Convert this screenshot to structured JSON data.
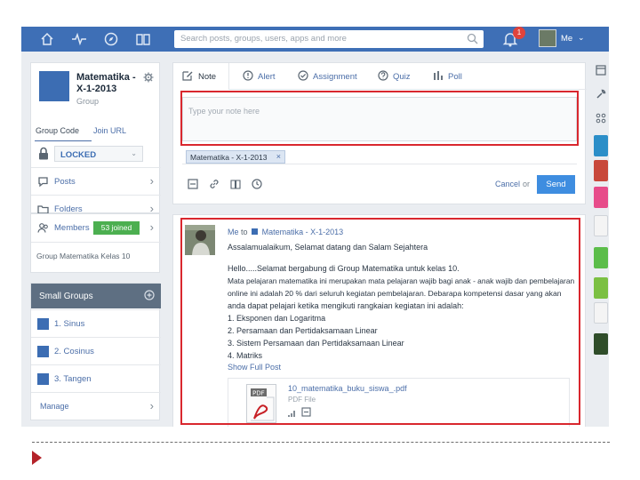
{
  "topbar": {
    "search_placeholder": "Search posts, groups, users, apps and more",
    "notifications_count": "1",
    "me_label": "Me",
    "nav_icons": [
      "home-icon",
      "activity-icon",
      "discover-icon",
      "backpack-icon"
    ]
  },
  "group": {
    "name": "Matematika - X-1-2013",
    "subtitle": "Group",
    "code_tabs": [
      "Group Code",
      "Join URL"
    ],
    "code_value": "LOCKED",
    "menu": [
      {
        "label": "Posts"
      },
      {
        "label": "Folders"
      },
      {
        "label": "Members",
        "badge": "53 joined"
      }
    ],
    "footer": "Group Matematika Kelas 10"
  },
  "small_groups": {
    "title": "Small Groups",
    "items": [
      "1. Sinus",
      "2. Cosinus",
      "3. Tangen"
    ],
    "manage": "Manage"
  },
  "composer": {
    "tabs": [
      "Note",
      "Alert",
      "Assignment",
      "Quiz",
      "Poll"
    ],
    "placeholder": "Type your note here",
    "recipient_tag": "Matematika - X-1-2013",
    "cancel": "Cancel",
    "or": "or",
    "send": "Send"
  },
  "post": {
    "author": "Me",
    "to": "to",
    "group": "Matematika - X-1-2013",
    "lines": [
      "Assalamualaikum, Selamat datang dan Salam Sejahtera",
      "",
      "Hello.....Selamat bergabung di Group Matematika untuk kelas 10.",
      "Mata pelajaran matematika ini merupakan mata pelajaran wajib bagi anak - anak wajib dan pembelajaran",
      "online ini adalah 20 % dari seluruh kegiatan pembelajaran. Debarapa kompetensi dasar yang akan",
      "anda dapat pelajari ketika mengikuti rangkaian kegiatan ini adalah:",
      "1. Eksponen dan Logaritma",
      "2. Persamaan dan Pertidaksamaan Linear",
      "3. Sistem Persamaan dan Pertidaksamaan Linear",
      "4. Matriks"
    ],
    "show_full": "Show Full Post",
    "attachment_name": "10_matematika_buku_siswa_.pdf",
    "attachment_type": "PDF File"
  },
  "colors": {
    "topbar": "#3e6fb6",
    "accent": "#3c6db3",
    "highlight": "#d9272e",
    "joined": "#4caf50",
    "send": "#3e8de0"
  }
}
